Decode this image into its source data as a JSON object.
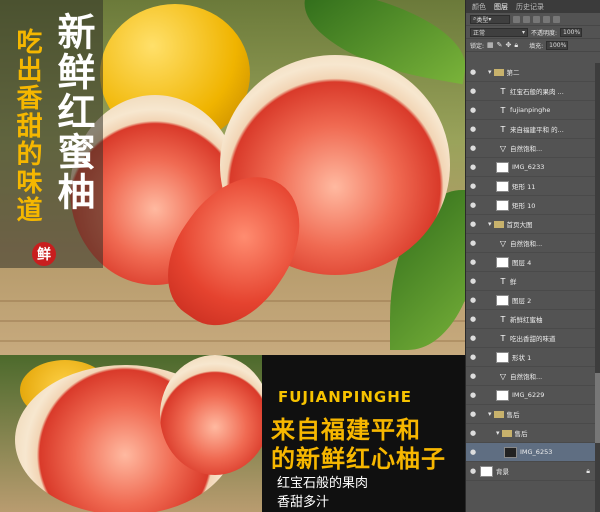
{
  "canvas": {
    "vertical_title": "新鲜红蜜柚",
    "vertical_subtitle": "吃出香甜的味道",
    "badge": "鲜",
    "bottom": {
      "english_title": "FUJIANPINGHE",
      "line1": "来自福建平和",
      "line2": "的新鲜红心柚子",
      "desc1": "红宝石般的果肉",
      "desc2": "香甜多汁"
    }
  },
  "panel": {
    "tabs": [
      "颜色",
      "图层",
      "历史记录"
    ],
    "kind_filter": "类型",
    "blend_mode": "正常",
    "opacity_label": "不透明度:",
    "opacity_value": "100%",
    "lock_label": "锁定:",
    "fill_label": "填充:",
    "fill_value": "100%",
    "layers": [
      {
        "name": "第二",
        "kind": "group"
      },
      {
        "name": "红宝石般的果肉 ...",
        "kind": "text"
      },
      {
        "name": "fujianpinghe",
        "kind": "text"
      },
      {
        "name": "来自福建平和 的...",
        "kind": "text"
      },
      {
        "name": "自然饱和...",
        "kind": "adjust"
      },
      {
        "name": "IMG_6233",
        "kind": "image"
      },
      {
        "name": "矩形 11",
        "kind": "shape"
      },
      {
        "name": "矩形 10",
        "kind": "shape"
      },
      {
        "name": "首页大图",
        "kind": "group"
      },
      {
        "name": "自然饱和...",
        "kind": "adjust"
      },
      {
        "name": "图层 4",
        "kind": "image"
      },
      {
        "name": "鲜",
        "kind": "text"
      },
      {
        "name": "图层 2",
        "kind": "image"
      },
      {
        "name": "新鲜红蜜柚",
        "kind": "text"
      },
      {
        "name": "吃出香甜的味道",
        "kind": "text"
      },
      {
        "name": "形状 1",
        "kind": "shape"
      },
      {
        "name": "自然饱和...",
        "kind": "adjust"
      },
      {
        "name": "IMG_6229",
        "kind": "image"
      },
      {
        "name": "售后",
        "kind": "group"
      },
      {
        "name": "售后",
        "kind": "group"
      },
      {
        "name": "IMG_6253",
        "kind": "image",
        "selected": true
      },
      {
        "name": "背景",
        "kind": "background"
      }
    ]
  }
}
